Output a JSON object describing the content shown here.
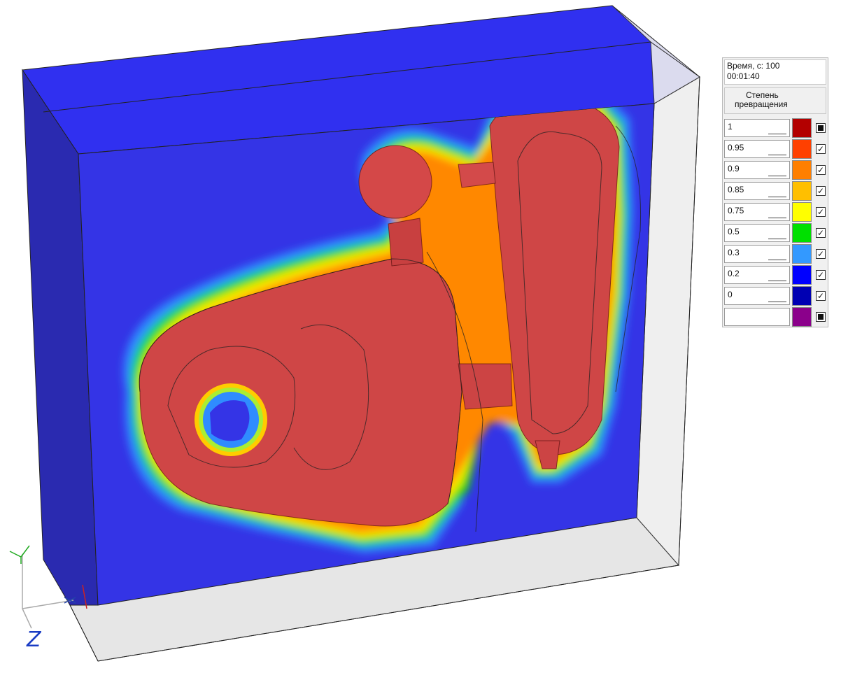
{
  "legend": {
    "time_line1": "Время, с: 100",
    "time_line2": "00:01:40",
    "title_line1": "Степень",
    "title_line2": "превращения",
    "rows": [
      {
        "value": "1",
        "color": "#b30000",
        "check": "filled"
      },
      {
        "value": "0.95",
        "color": "#ff4000",
        "check": "checked"
      },
      {
        "value": "0.9",
        "color": "#ff7f00",
        "check": "checked"
      },
      {
        "value": "0.85",
        "color": "#ffbf00",
        "check": "checked"
      },
      {
        "value": "0.75",
        "color": "#ffff00",
        "check": "checked"
      },
      {
        "value": "0.5",
        "color": "#00e000",
        "check": "checked"
      },
      {
        "value": "0.3",
        "color": "#3399ff",
        "check": "checked"
      },
      {
        "value": "0.2",
        "color": "#0000ff",
        "check": "checked"
      },
      {
        "value": "0",
        "color": "#0000b3",
        "check": "checked"
      },
      {
        "value": "",
        "color": "#8b008b",
        "check": "filled"
      }
    ]
  },
  "colors": {
    "mold": "#3434ee",
    "casting": "#d64545",
    "box": "#e8e8e8"
  },
  "axis_label": "Z"
}
